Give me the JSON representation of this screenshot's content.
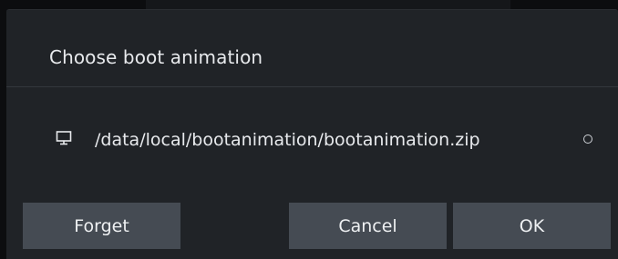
{
  "dialog": {
    "title": "Choose boot animation",
    "option": {
      "icon": "monitor-icon",
      "path": "/data/local/bootanimation/bootanimation.zip",
      "selected": false
    },
    "buttons": {
      "forget": "Forget",
      "cancel": "Cancel",
      "ok": "OK"
    }
  },
  "colors": {
    "dialog_bg": "#202327",
    "button_bg": "#454b53",
    "text": "#e8eaed"
  }
}
